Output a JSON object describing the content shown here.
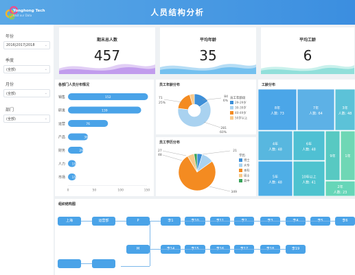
{
  "header": {
    "title": "人员结构分析",
    "logo_name": "Yonghong Tech",
    "logo_sub": "Visit our Data",
    "accent": "#3b8ee0"
  },
  "filters": [
    {
      "label": "年份",
      "value": "2016|2017|2018"
    },
    {
      "label": "季度",
      "value": "(全部)"
    },
    {
      "label": "月份",
      "value": "(全部)"
    },
    {
      "label": "部门",
      "value": "(全部)"
    }
  ],
  "kpis": [
    {
      "title": "期末总人数",
      "value": "457",
      "wave_color": "#b487ea"
    },
    {
      "title": "平均年龄",
      "value": "35",
      "wave_color": "#5cb5ec"
    },
    {
      "title": "平均工龄",
      "value": "6",
      "wave_color": "#7ed8d4"
    }
  ],
  "dept_chart": {
    "title": "各部门人员分布情况",
    "chart_data": {
      "type": "bar",
      "orientation": "horizontal",
      "categories": [
        "销售",
        "研发",
        "运营",
        "产品",
        "财务",
        "人力",
        "市场"
      ],
      "values": [
        152,
        139,
        76,
        38,
        29,
        15,
        15
      ],
      "xlim": [
        0,
        150
      ],
      "xticks": [
        "0",
        "50",
        "100",
        "150"
      ]
    }
  },
  "age_chart": {
    "title": "员工年龄分布",
    "legend_title": "员工年龄段",
    "chart_data": {
      "type": "pie",
      "donut": true,
      "labels": [
        "29-29岁",
        "30-39岁",
        "40-49岁",
        "50岁以上"
      ],
      "values": [
        71,
        281,
        84,
        21
      ],
      "colors": [
        "#3d8fd8",
        "#a9d2f0",
        "#f48b21",
        "#f9c98a"
      ],
      "annotations": [
        {
          "value": "71",
          "pct": "25%"
        },
        {
          "value": "84",
          "pct": "6%"
        },
        {
          "value": "281",
          "pct": "60%"
        }
      ]
    }
  },
  "edu_chart": {
    "title": "员工学历分布",
    "legend_title": "学历",
    "chart_data": {
      "type": "pie",
      "labels": [
        "博士",
        "大专",
        "本科",
        "硕士",
        "高中"
      ],
      "values": [
        21,
        48,
        349,
        27,
        12
      ],
      "colors": [
        "#3d8fd8",
        "#a9d2f0",
        "#f48b21",
        "#f9c98a",
        "#3aa35a"
      ],
      "annotations": [
        {
          "value": "27"
        },
        {
          "value": "48"
        },
        {
          "value": "21"
        },
        {
          "value": "349"
        }
      ]
    }
  },
  "tenure_chart": {
    "title": "工龄分布",
    "chart_data": {
      "type": "treemap",
      "items": [
        {
          "label": "8年",
          "value_label": "人数: 73",
          "value": 73,
          "color": "#4ba6e8"
        },
        {
          "label": "7年",
          "value_label": "人数: 64",
          "value": 64,
          "color": "#5db1e6"
        },
        {
          "label": "3年",
          "value_label": "人数: 48",
          "value": 48,
          "color": "#5cc2d8"
        },
        {
          "label": "4年",
          "value_label": "人数: 48",
          "value": 48,
          "color": "#58b7df"
        },
        {
          "label": "6年",
          "value_label": "人数: 48",
          "value": 48,
          "color": "#4fc0d3"
        },
        {
          "label": "9年",
          "value_label": "",
          "value": 38,
          "color": "#58c9c2"
        },
        {
          "label": "1年",
          "value_label": "",
          "value": 24,
          "color": "#6fd7b5"
        },
        {
          "label": "5年",
          "value_label": "人数: 48",
          "value": 48,
          "color": "#4eaee6"
        },
        {
          "label": "10年以上",
          "value_label": "人数: 41",
          "value": 41,
          "color": "#4ec3cf"
        },
        {
          "label": "2年",
          "value_label": "人数: 23",
          "value": 23,
          "color": "#66d6b8"
        }
      ]
    }
  },
  "org": {
    "title": "组织结构图",
    "row1": [
      "上海",
      "运营部",
      "P",
      "李1",
      "李10",
      "李11",
      "李2",
      "李3",
      "李4",
      "李5",
      "李6"
    ],
    "row2": [
      "M",
      "李14",
      "李15",
      "李16",
      "李17",
      "李18",
      "李19"
    ]
  }
}
